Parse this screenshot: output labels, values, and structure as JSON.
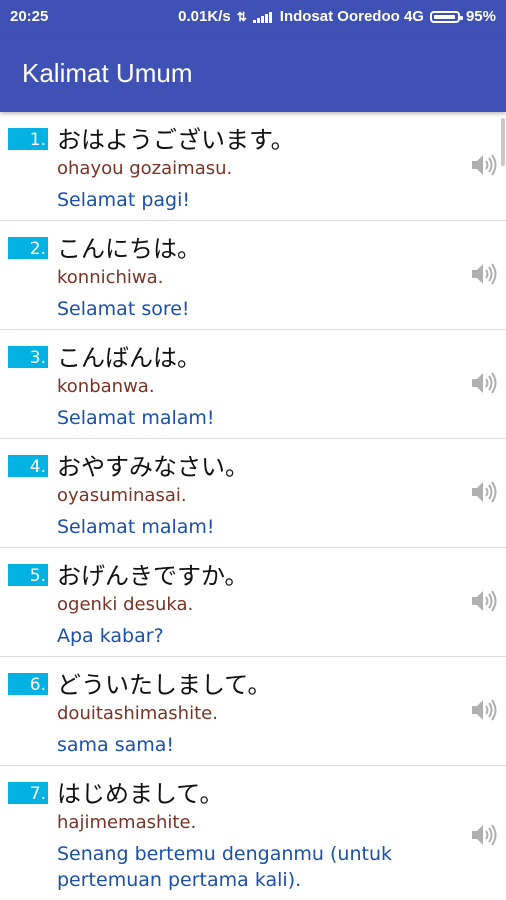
{
  "status_bar": {
    "time": "20:25",
    "speed": "0.01K/s",
    "carrier": "Indosat Ooredoo 4G",
    "battery": "95%"
  },
  "toolbar": {
    "title": "Kalimat Umum"
  },
  "items": [
    {
      "number": "1.",
      "japanese": "おはようございます。",
      "romaji": "ohayou gozaimasu.",
      "meaning": "Selamat pagi!"
    },
    {
      "number": "2.",
      "japanese": "こんにちは。",
      "romaji": "konnichiwa.",
      "meaning": "Selamat sore!"
    },
    {
      "number": "3.",
      "japanese": "こんばんは。",
      "romaji": "konbanwa.",
      "meaning": "Selamat malam!"
    },
    {
      "number": "4.",
      "japanese": "おやすみなさい。",
      "romaji": "oyasuminasai.",
      "meaning": "Selamat malam!"
    },
    {
      "number": "5.",
      "japanese": "おげんきですか。",
      "romaji": "ogenki desuka.",
      "meaning": "Apa kabar?"
    },
    {
      "number": "6.",
      "japanese": "どういたしまして。",
      "romaji": "douitashimashite.",
      "meaning": "sama sama!"
    },
    {
      "number": "7.",
      "japanese": "はじめまして。",
      "romaji": "hajimemashite.",
      "meaning": "Senang bertemu denganmu (untuk pertemuan pertama kali)."
    }
  ],
  "colors": {
    "primary": "#3f51b5",
    "number_badge": "#03b2e3",
    "romaji": "#7b3326",
    "meaning": "#1b4fb0"
  },
  "icons": {
    "speaker": "speaker-icon"
  }
}
